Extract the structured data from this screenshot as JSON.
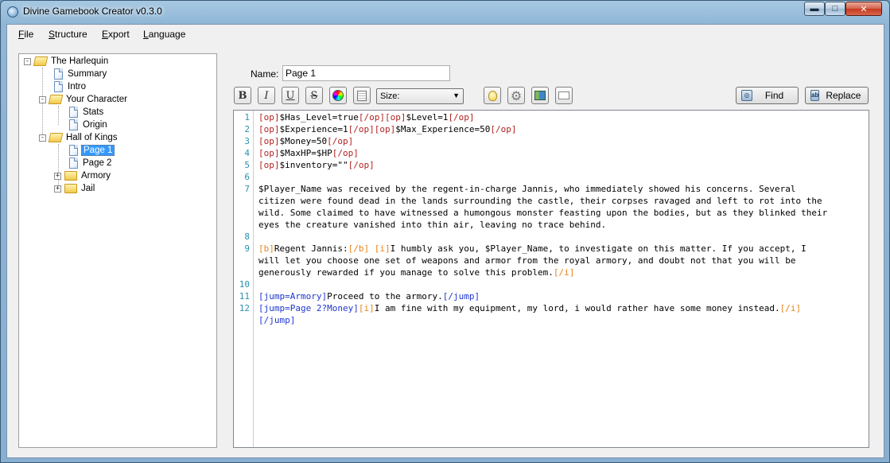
{
  "window": {
    "title": "Divine Gamebook Creator v0.3.0"
  },
  "menu": {
    "file": {
      "acc": "F",
      "rest": "ile"
    },
    "structure": {
      "acc": "S",
      "rest": "tructure"
    },
    "export": {
      "acc": "E",
      "rest": "xport"
    },
    "language": {
      "acc": "L",
      "rest": "anguage"
    }
  },
  "tree": {
    "root": "The Harlequin",
    "summary": "Summary",
    "intro": "Intro",
    "your_character": "Your Character",
    "stats": "Stats",
    "origin": "Origin",
    "hall_of_kings": "Hall of Kings",
    "page1": "Page 1",
    "page2": "Page 2",
    "armory": "Armory",
    "jail": "Jail"
  },
  "editor": {
    "name_label": "Name:",
    "name_value": "Page 1",
    "size_placeholder": "Size:",
    "find_label": "Find",
    "replace_label": "Replace",
    "line_numbers": [
      "1",
      "2",
      "3",
      "4",
      "5",
      "6",
      "7",
      "8",
      "9",
      "10",
      "11",
      "12"
    ],
    "lines": {
      "l1": {
        "a": "[op]",
        "b": "$Has_Level=true",
        "c": "[/op][op]",
        "d": "$Level=1",
        "e": "[/op]"
      },
      "l2": {
        "a": "[op]",
        "b": "$Experience=1",
        "c": "[/op][op]",
        "d": "$Max_Experience=50",
        "e": "[/op]"
      },
      "l3": {
        "a": "[op]",
        "b": "$Money=50",
        "c": "[/op]"
      },
      "l4": {
        "a": "[op]",
        "b": "$MaxHP=$HP",
        "c": "[/op]"
      },
      "l5": {
        "a": "[op]",
        "b": "$inventory=\"\"",
        "c": "[/op]"
      },
      "l7_1": "$Player_Name was received by the regent-in-charge Jannis, who immediately showed his concerns. Several",
      "l7_2": "citizen were found dead in the lands surrounding the castle, their corpses ravaged and left to rot into the",
      "l7_3": "wild. Some claimed to have witnessed a humongous monster feasting upon the bodies, but as they blinked their",
      "l7_4": "eyes the creature vanished into thin air, leaving no trace behind.",
      "l9_1": {
        "a": "[b]",
        "b": "Regent Jannis:",
        "c": "[/b] [i]",
        "d": "I humbly ask you, $Player_Name, to investigate on this matter. If you accept, I"
      },
      "l9_2": "will let you choose one set of weapons and armor from the royal armory, and doubt not that you will be",
      "l9_3": {
        "a": "generously rewarded if you manage to solve this problem.",
        "b": "[/i]"
      },
      "l11": {
        "a": "[jump=Armory]",
        "b": "Proceed to the armory.",
        "c": "[/jump]"
      },
      "l12": {
        "a": "[jump=Page 2?Money]",
        "b": "[i]",
        "c": "I am fine with my equipment, my lord, i would rather have some money instead.",
        "d": "[/i]"
      },
      "l12_2": "[/jump]"
    }
  },
  "colors": {
    "op": "#b22222",
    "tag": "#e8831d",
    "jump": "#1f36d1",
    "line_number": "#2b91af",
    "selection": "#3399ff"
  },
  "icons": [
    "app-icon",
    "minimize-icon",
    "maximize-icon",
    "close-icon",
    "folder-icon",
    "page-icon",
    "color-wheel-icon",
    "lightbulb-icon",
    "gear-icon",
    "export-icon",
    "binoculars-icon",
    "replace-icon"
  ]
}
